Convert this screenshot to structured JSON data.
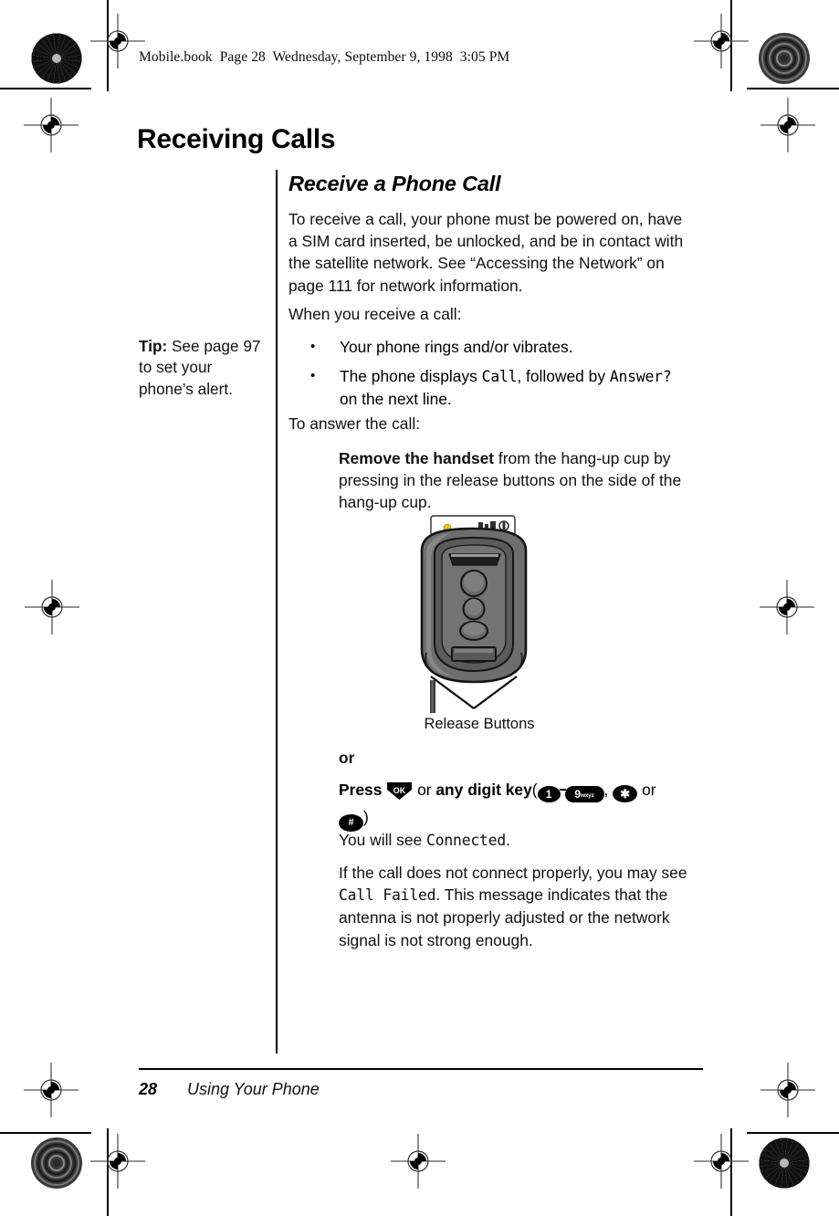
{
  "slug": "Mobile.book  Page 28  Wednesday, September 9, 1998  3:05 PM",
  "chapter_title": "Receiving Calls",
  "section_title": "Receive a Phone Call",
  "paragraphs": {
    "intro": "To receive a call, your phone must be powered on, have a SIM card inserted, be unlocked, and be in contact with the satellite network. See “Accessing the Network” on page 111 for network information.",
    "when_you_receive": "When you receive a call:",
    "to_answer": "To answer the call:",
    "you_will_see_prefix": "You will see ",
    "you_will_see_lcd": "Connected",
    "you_will_see_suffix": ".",
    "failure_part1": "If the call does not connect properly, you may see ",
    "failure_lcd": "Call Failed",
    "failure_part2": ". This message indicates that the antenna is not properly adjusted or the network signal is not strong enough."
  },
  "bullets": [
    {
      "mark": "•",
      "text": "Your phone rings and/or vibrates."
    },
    {
      "mark": "•",
      "prefix": "The phone displays ",
      "lcd1": "Call",
      "middle": ", followed by ",
      "lcd2": "Answer?",
      "suffix": " on the next line."
    }
  ],
  "steps": {
    "remove_bold": "Remove the handset",
    "remove_rest": " from the hang-up cup by pressing in the release buttons on the side of the hang-up cup.",
    "or_label": "or",
    "press_label": "Press",
    "or_middle": "or",
    "any_digit_key": "any digit key",
    "open_paren": "(",
    "comma": ",",
    "or_tail": "or",
    "close_paren": ")"
  },
  "keys": {
    "ok": "OK",
    "one": "1",
    "nine_digit": "9",
    "nine_letters": "wxyz",
    "star": "✱",
    "hash": "#"
  },
  "tip": {
    "label": "Tip:",
    "text": " See page 97 to set your phone’s alert."
  },
  "illustration": {
    "callout_label": "Release Buttons",
    "body_color": "#6e6e6e",
    "body_dark": "#4a4a4a",
    "body_light": "#8a8a8a",
    "led_color": "#f0c419",
    "outline_color": "#1a1a1a"
  },
  "footer": {
    "page_number": "28",
    "running_head": "Using Your Phone"
  }
}
